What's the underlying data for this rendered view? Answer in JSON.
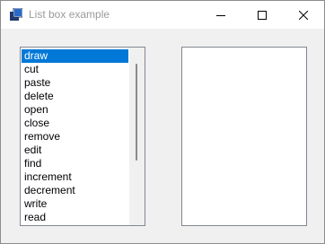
{
  "window": {
    "title": "List box example"
  },
  "icons": {
    "app": "app-icon",
    "minimize": "minimize-icon",
    "maximize": "maximize-icon",
    "close": "close-icon"
  },
  "listbox_left": {
    "selected_index": 0,
    "items": [
      "draw",
      "cut",
      "paste",
      "delete",
      "open",
      "close",
      "remove",
      "edit",
      "find",
      "increment",
      "decrement",
      "write",
      "read"
    ]
  },
  "listbox_right": {
    "items": []
  },
  "colors": {
    "selection": "#0078d7",
    "window_bg": "#f0f0f0"
  }
}
